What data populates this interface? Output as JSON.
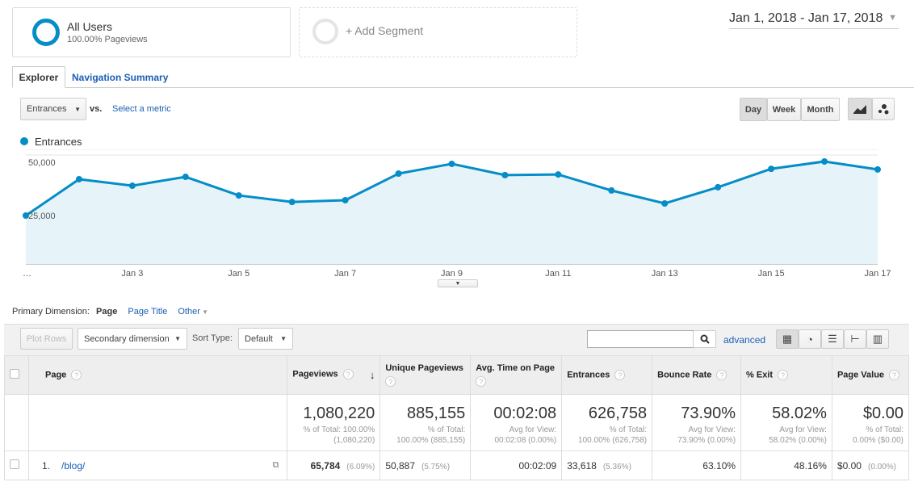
{
  "segments": [
    {
      "name": "All Users",
      "detail": "100.00% Pageviews"
    },
    {
      "name": "+ Add Segment"
    }
  ],
  "date_range": "Jan 1, 2018 - Jan 17, 2018",
  "tabs": [
    {
      "label": "Explorer",
      "active": true
    },
    {
      "label": "Navigation Summary"
    }
  ],
  "metric_select": "Entrances",
  "vs": "vs.",
  "select_metric": "Select a metric",
  "granularity": [
    "Day",
    "Week",
    "Month"
  ],
  "granularity_selected": "Day",
  "chart_icons": [
    "line-chart-icon",
    "motion-chart-icon"
  ],
  "chart_data": {
    "type": "line",
    "legend": "Entrances",
    "color": "#058dc7",
    "x": [
      "Jan 1",
      "Jan 2",
      "Jan 3",
      "Jan 4",
      "Jan 5",
      "Jan 6",
      "Jan 7",
      "Jan 8",
      "Jan 9",
      "Jan 10",
      "Jan 11",
      "Jan 12",
      "Jan 13",
      "Jan 14",
      "Jan 15",
      "Jan 16",
      "Jan 17"
    ],
    "values": [
      25000,
      41800,
      38800,
      42900,
      34300,
      31300,
      32100,
      44400,
      48900,
      43700,
      44000,
      36600,
      30600,
      38100,
      46600,
      50000,
      46300
    ],
    "yticks": [
      "25,000",
      "50,000"
    ],
    "xticks": [
      "...",
      "Jan 3",
      "Jan 5",
      "Jan 7",
      "Jan 9",
      "Jan 11",
      "Jan 13",
      "Jan 15",
      "Jan 17"
    ],
    "ylim": [
      0,
      50000
    ],
    "grid": true
  },
  "primary_dimension": {
    "label": "Primary Dimension:",
    "options": [
      "Page",
      "Page Title",
      "Other"
    ],
    "selected": "Page"
  },
  "toolbar": {
    "plot_rows": "Plot Rows",
    "secondary": "Secondary dimension",
    "sort_label": "Sort Type:",
    "sort_value": "Default",
    "search_value": "",
    "advanced": "advanced",
    "views": [
      "table-icon",
      "pie-icon",
      "bar-icon",
      "comparison-icon",
      "pivot-icon"
    ]
  },
  "table": {
    "headers": [
      "Page",
      "Pageviews",
      "Unique Pageviews",
      "Avg. Time on Page",
      "Entrances",
      "Bounce Rate",
      "% Exit",
      "Page Value"
    ],
    "totals": [
      {
        "value": "1,080,220",
        "l1": "% of Total: 100.00%",
        "l2": "(1,080,220)"
      },
      {
        "value": "885,155",
        "l1": "% of Total:",
        "l2": "100.00% (885,155)"
      },
      {
        "value": "00:02:08",
        "l1": "Avg for View:",
        "l2": "00:02:08 (0.00%)"
      },
      {
        "value": "626,758",
        "l1": "% of Total:",
        "l2": "100.00% (626,758)"
      },
      {
        "value": "73.90%",
        "l1": "Avg for View:",
        "l2": "73.90% (0.00%)"
      },
      {
        "value": "58.02%",
        "l1": "Avg for View:",
        "l2": "58.02% (0.00%)"
      },
      {
        "value": "$0.00",
        "l1": "% of Total:",
        "l2": "0.00% ($0.00)"
      }
    ],
    "rows": [
      {
        "index": "1.",
        "page": "/blog/",
        "pageviews": "65,784",
        "pageviews_pct": "(6.09%)",
        "unique": "50,887",
        "unique_pct": "(5.75%)",
        "avg_time": "00:02:09",
        "entrances": "33,618",
        "entrances_pct": "(5.36%)",
        "bounce": "63.10%",
        "exit": "48.16%",
        "value": "$0.00",
        "value_pct": "(0.00%)"
      }
    ]
  }
}
